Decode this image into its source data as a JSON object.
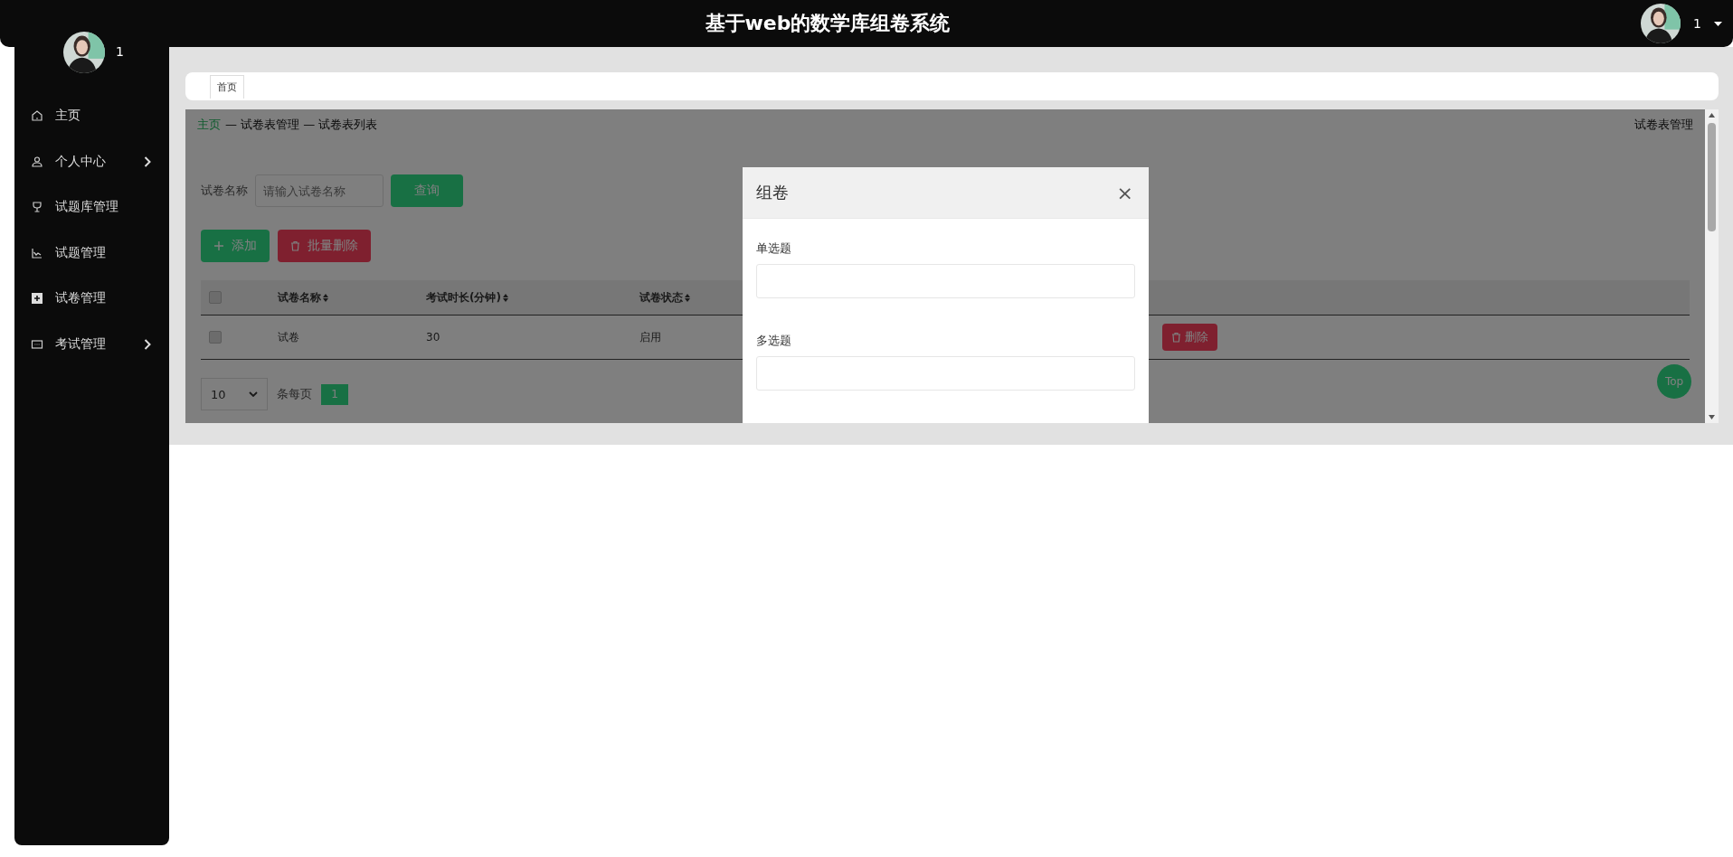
{
  "header": {
    "title": "基于web的数学库组卷系统",
    "user": {
      "name": "1"
    }
  },
  "sidebar": {
    "user": {
      "name": "1"
    },
    "items": [
      {
        "label": "主页",
        "kind": "home",
        "expandable": false
      },
      {
        "label": "个人中心",
        "kind": "user",
        "expandable": true
      },
      {
        "label": "试题库管理",
        "kind": "trophy",
        "expandable": false
      },
      {
        "label": "试题管理",
        "kind": "chart",
        "expandable": false
      },
      {
        "label": "试卷管理",
        "kind": "plus",
        "expandable": false
      },
      {
        "label": "考试管理",
        "kind": "dots",
        "expandable": true
      }
    ]
  },
  "tabs": [
    {
      "label": "首页",
      "selected": true
    }
  ],
  "breadcrumb": {
    "home": "主页",
    "trail": "— 试卷表管理 — 试卷表列表",
    "page_title": "试卷表管理"
  },
  "search": {
    "label": "试卷名称",
    "placeholder": "请输入试卷名称",
    "button": "查询"
  },
  "actions": [
    {
      "kind": "add",
      "label": "添加"
    },
    {
      "kind": "delete",
      "label": "批量删除"
    }
  ],
  "table": {
    "header_checked": false,
    "columns": [
      {
        "label": "试卷名称",
        "sortable": true
      },
      {
        "label": "考试时长(分钟)",
        "sortable": true
      },
      {
        "label": "试卷状态",
        "sortable": true
      }
    ],
    "rows": [
      {
        "checked": false,
        "cells": [
          "试卷",
          "30",
          "启用"
        ],
        "actions": [
          {
            "kind": "delete",
            "label": "删除"
          }
        ]
      }
    ]
  },
  "pagination": {
    "page_size": "10",
    "size_label": "条每页",
    "pages": [
      {
        "label": "1",
        "selected": true
      }
    ]
  },
  "top_button": "Top",
  "modal": {
    "title": "组卷",
    "close": "×",
    "fields": [
      {
        "label": "单选题"
      },
      {
        "label": "多选题"
      }
    ]
  }
}
